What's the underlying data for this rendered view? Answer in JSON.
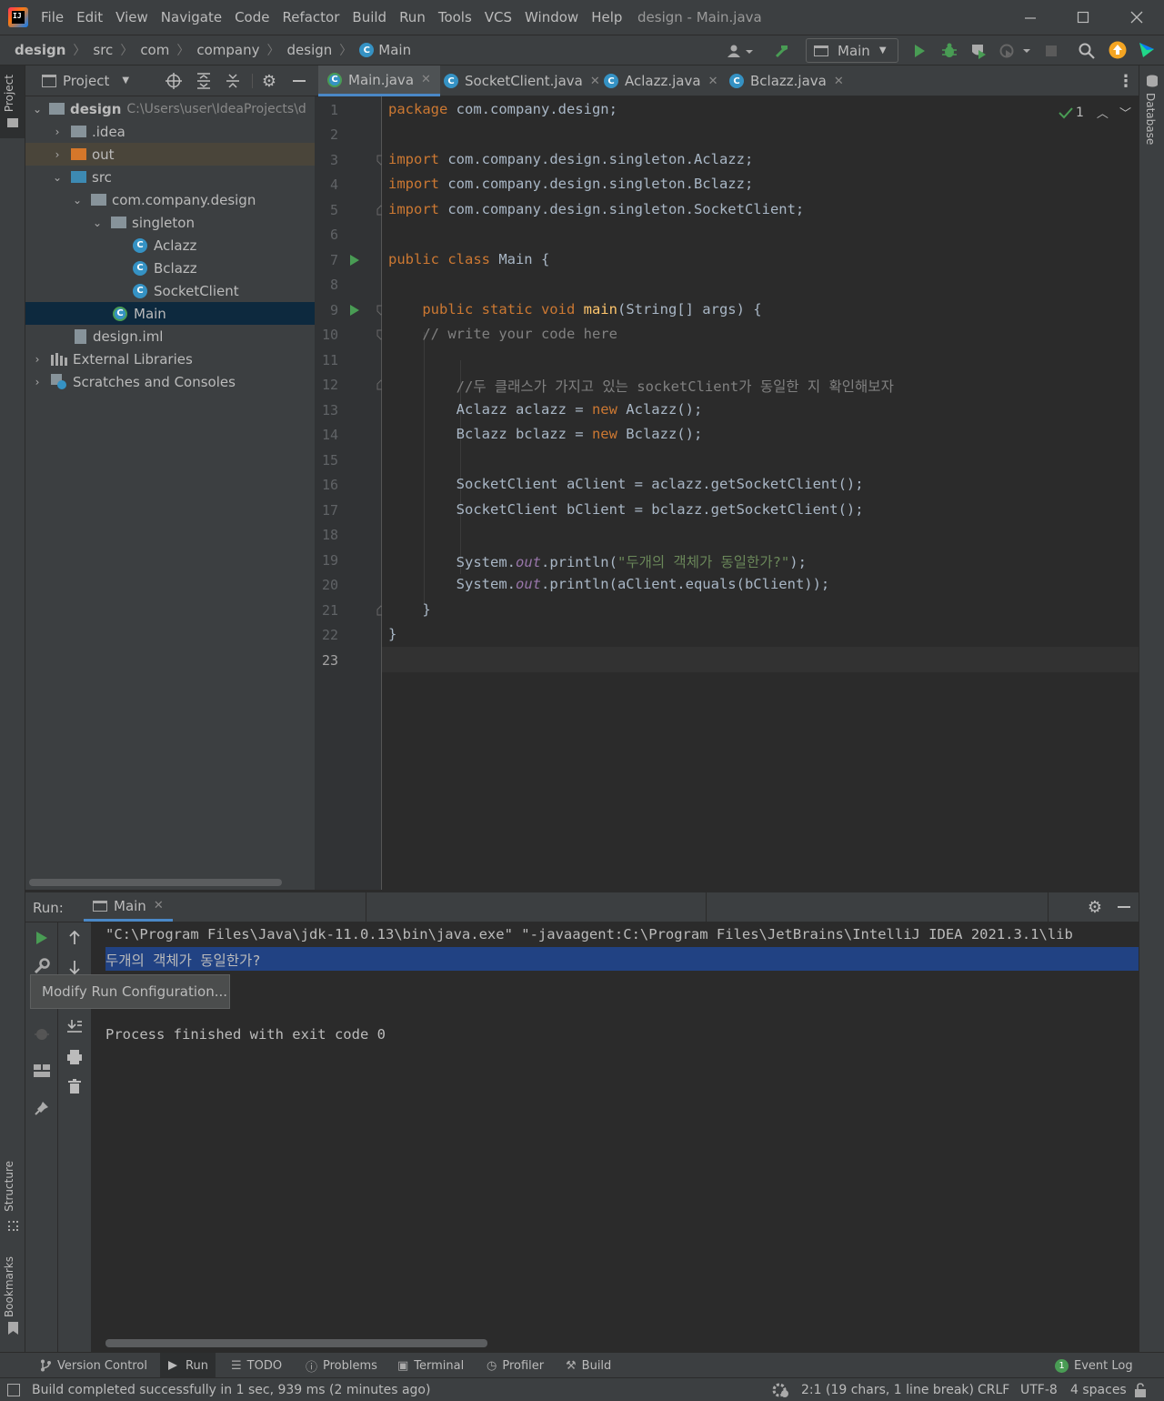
{
  "window": {
    "title": "design - Main.java",
    "menu": [
      "File",
      "Edit",
      "View",
      "Navigate",
      "Code",
      "Refactor",
      "Build",
      "Run",
      "Tools",
      "VCS",
      "Window",
      "Help"
    ]
  },
  "breadcrumb": [
    "design",
    "src",
    "com",
    "company",
    "design",
    "Main"
  ],
  "run_config": "Main",
  "left_stripe": {
    "project": "Project",
    "structure": "Structure",
    "bookmarks": "Bookmarks"
  },
  "right_stripe": {
    "database": "Database"
  },
  "project_panel": {
    "title": "Project",
    "tree": [
      {
        "label": "design",
        "extra": "C:\\Users\\user\\IdeaProjects\\d"
      },
      {
        "label": ".idea"
      },
      {
        "label": "out"
      },
      {
        "label": "src"
      },
      {
        "label": "com.company.design"
      },
      {
        "label": "singleton"
      },
      {
        "label": "Aclazz"
      },
      {
        "label": "Bclazz"
      },
      {
        "label": "SocketClient"
      },
      {
        "label": "Main"
      },
      {
        "label": "design.iml"
      },
      {
        "label": "External Libraries"
      },
      {
        "label": "Scratches and Consoles"
      }
    ]
  },
  "tabs": [
    {
      "label": "Main.java",
      "active": true
    },
    {
      "label": "SocketClient.java"
    },
    {
      "label": "Aclazz.java"
    },
    {
      "label": "Bclazz.java"
    }
  ],
  "editor": {
    "inspection_count": "1",
    "line_numbers": [
      "1",
      "2",
      "3",
      "4",
      "5",
      "6",
      "7",
      "8",
      "9",
      "10",
      "11",
      "12",
      "13",
      "14",
      "15",
      "16",
      "17",
      "18",
      "19",
      "20",
      "21",
      "22",
      "23"
    ],
    "code": {
      "l1_kw": "package",
      "l1_rest": " com.company.design;",
      "l3_kw": "import",
      "l3_rest": " com.company.design.singleton.Aclazz;",
      "l4_kw": "import",
      "l4_rest": " com.company.design.singleton.Bclazz;",
      "l5_kw": "import",
      "l5_rest": " com.company.design.singleton.SocketClient;",
      "l7_kw": "public class",
      "l7_rest": " Main {",
      "l9_kw": "    public static void",
      "l9_fn": " main",
      "l9_rest": "(String[] args) {",
      "l10": "    // write your code here",
      "l12": "        //두 클래스가 가지고 있는 socketClient가 동일한 지 확인해보자",
      "l13_a": "        Aclazz aclazz = ",
      "l13_kw": "new",
      "l13_b": " Aclazz();",
      "l14_a": "        Bclazz bclazz = ",
      "l14_kw": "new",
      "l14_b": " Bclazz();",
      "l16": "        SocketClient aClient = aclazz.getSocketClient();",
      "l17": "        SocketClient bClient = bclazz.getSocketClient();",
      "l19_a": "        System.",
      "l19_fld": "out",
      "l19_b": ".println(",
      "l19_str": "\"두개의 객체가 동일한가?\"",
      "l19_c": ");",
      "l20_a": "        System.",
      "l20_fld": "out",
      "l20_b": ".println(aClient.equals(bClient));",
      "l21": "    }",
      "l22": "}"
    }
  },
  "run_panel": {
    "label": "Run:",
    "tab": "Main",
    "console": [
      "\"C:\\Program Files\\Java\\jdk-11.0.13\\bin\\java.exe\" \"-javaagent:C:\\Program Files\\JetBrains\\IntelliJ IDEA 2021.3.1\\lib",
      "두개의 객체가 동일한가?",
      "Process finished with exit code 0"
    ],
    "tooltip": "Modify Run Configuration..."
  },
  "bottom_tools": [
    "Version Control",
    "Run",
    "TODO",
    "Problems",
    "Terminal",
    "Profiler",
    "Build"
  ],
  "event_log": {
    "count": "1",
    "label": "Event Log"
  },
  "status": {
    "message": "Build completed successfully in 1 sec, 939 ms (2 minutes ago)",
    "position": "2:1 (19 chars, 1 line break)",
    "line_sep": "CRLF",
    "encoding": "UTF-8",
    "indent": "4 spaces"
  },
  "colors": {
    "accent": "#4a88c7",
    "selection": "#0d293e",
    "console_selection": "#214283",
    "run_green": "#499c54"
  }
}
